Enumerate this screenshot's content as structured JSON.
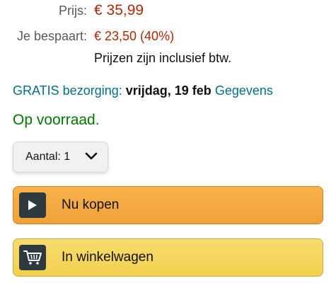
{
  "pricing": {
    "price_label": "Prijs:",
    "price_value": "€ 35,99",
    "savings_label": "Je bespaart:",
    "savings_value": "€ 23,50 (40%)",
    "vat_note": "Prijzen zijn inclusief btw."
  },
  "delivery": {
    "free_label": "GRATIS bezorging:",
    "date": "vrijdag, 19 feb",
    "details_link": "Gegevens"
  },
  "stock": {
    "status": "Op voorraad."
  },
  "quantity": {
    "label": "Aantal:",
    "value": "1"
  },
  "actions": {
    "buy_now": "Nu kopen",
    "add_to_cart": "In winkelwagen"
  },
  "colors": {
    "price": "#B12704",
    "link": "#007185",
    "in_stock": "#007600",
    "buy_button": "#F0A13A",
    "cart_button": "#F2CF4D"
  },
  "icons": {
    "buy_icon": "play-icon",
    "cart_icon": "shopping-cart-icon",
    "qty_icon": "chevron-down-icon"
  }
}
